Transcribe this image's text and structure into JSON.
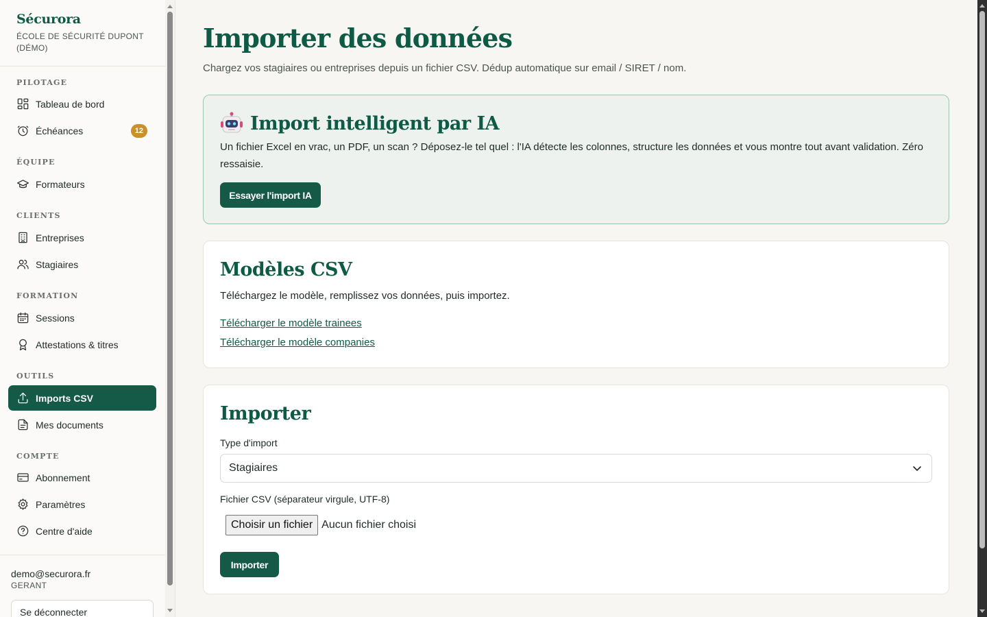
{
  "brand": {
    "name": "Sécurora",
    "school": "ÉCOLE DE SÉCURITÉ DUPONT (DÉMO)"
  },
  "sidebar": {
    "sections": [
      {
        "label": "PILOTAGE",
        "items": [
          {
            "label": "Tableau de bord",
            "icon": "dashboard-icon"
          },
          {
            "label": "Échéances",
            "icon": "clock-icon",
            "badge": "12"
          }
        ]
      },
      {
        "label": "ÉQUIPE",
        "items": [
          {
            "label": "Formateurs",
            "icon": "graduation-cap-icon"
          }
        ]
      },
      {
        "label": "CLIENTS",
        "items": [
          {
            "label": "Entreprises",
            "icon": "building-icon"
          },
          {
            "label": "Stagiaires",
            "icon": "users-icon"
          }
        ]
      },
      {
        "label": "FORMATION",
        "items": [
          {
            "label": "Sessions",
            "icon": "calendar-icon"
          },
          {
            "label": "Attestations & titres",
            "icon": "award-icon"
          }
        ]
      },
      {
        "label": "OUTILS",
        "items": [
          {
            "label": "Imports CSV",
            "icon": "upload-icon",
            "active": true
          },
          {
            "label": "Mes documents",
            "icon": "document-icon"
          }
        ]
      },
      {
        "label": "COMPTE",
        "items": [
          {
            "label": "Abonnement",
            "icon": "credit-card-icon"
          },
          {
            "label": "Paramètres",
            "icon": "gear-icon"
          },
          {
            "label": "Centre d'aide",
            "icon": "help-icon"
          }
        ]
      }
    ]
  },
  "user": {
    "email": "demo@securora.fr",
    "role": "GERANT",
    "logout_label": "Se déconnecter"
  },
  "page": {
    "title": "Importer des données",
    "subtitle": "Chargez vos stagiaires ou entreprises depuis un fichier CSV. Dédup automatique sur email / SIRET / nom."
  },
  "ai_card": {
    "title": "Import intelligent par IA",
    "icon": "robot-icon",
    "text": "Un fichier Excel en vrac, un PDF, un scan ? Déposez-le tel quel : l'IA détecte les colonnes, structure les données et vous montre tout avant validation. Zéro ressaisie.",
    "button_label": "Essayer l'import IA"
  },
  "models_card": {
    "title": "Modèles CSV",
    "description": "Téléchargez le modèle, remplissez vos données, puis importez.",
    "link_trainees": "Télécharger le modèle trainees",
    "link_companies": "Télécharger le modèle companies"
  },
  "import_card": {
    "title": "Importer",
    "type_label": "Type d'import",
    "type_value": "Stagiaires",
    "file_label": "Fichier CSV (séparateur virgule, UTF-8)",
    "file_button": "Choisir un fichier",
    "file_status": "Aucun fichier choisi",
    "submit_label": "Importer"
  },
  "colors": {
    "brand": "#0f5a45",
    "primary_button": "#155a47",
    "badge": "#c9902b",
    "ai_card_bg": "#eef2ee",
    "ai_card_border": "#9dc3b3"
  }
}
